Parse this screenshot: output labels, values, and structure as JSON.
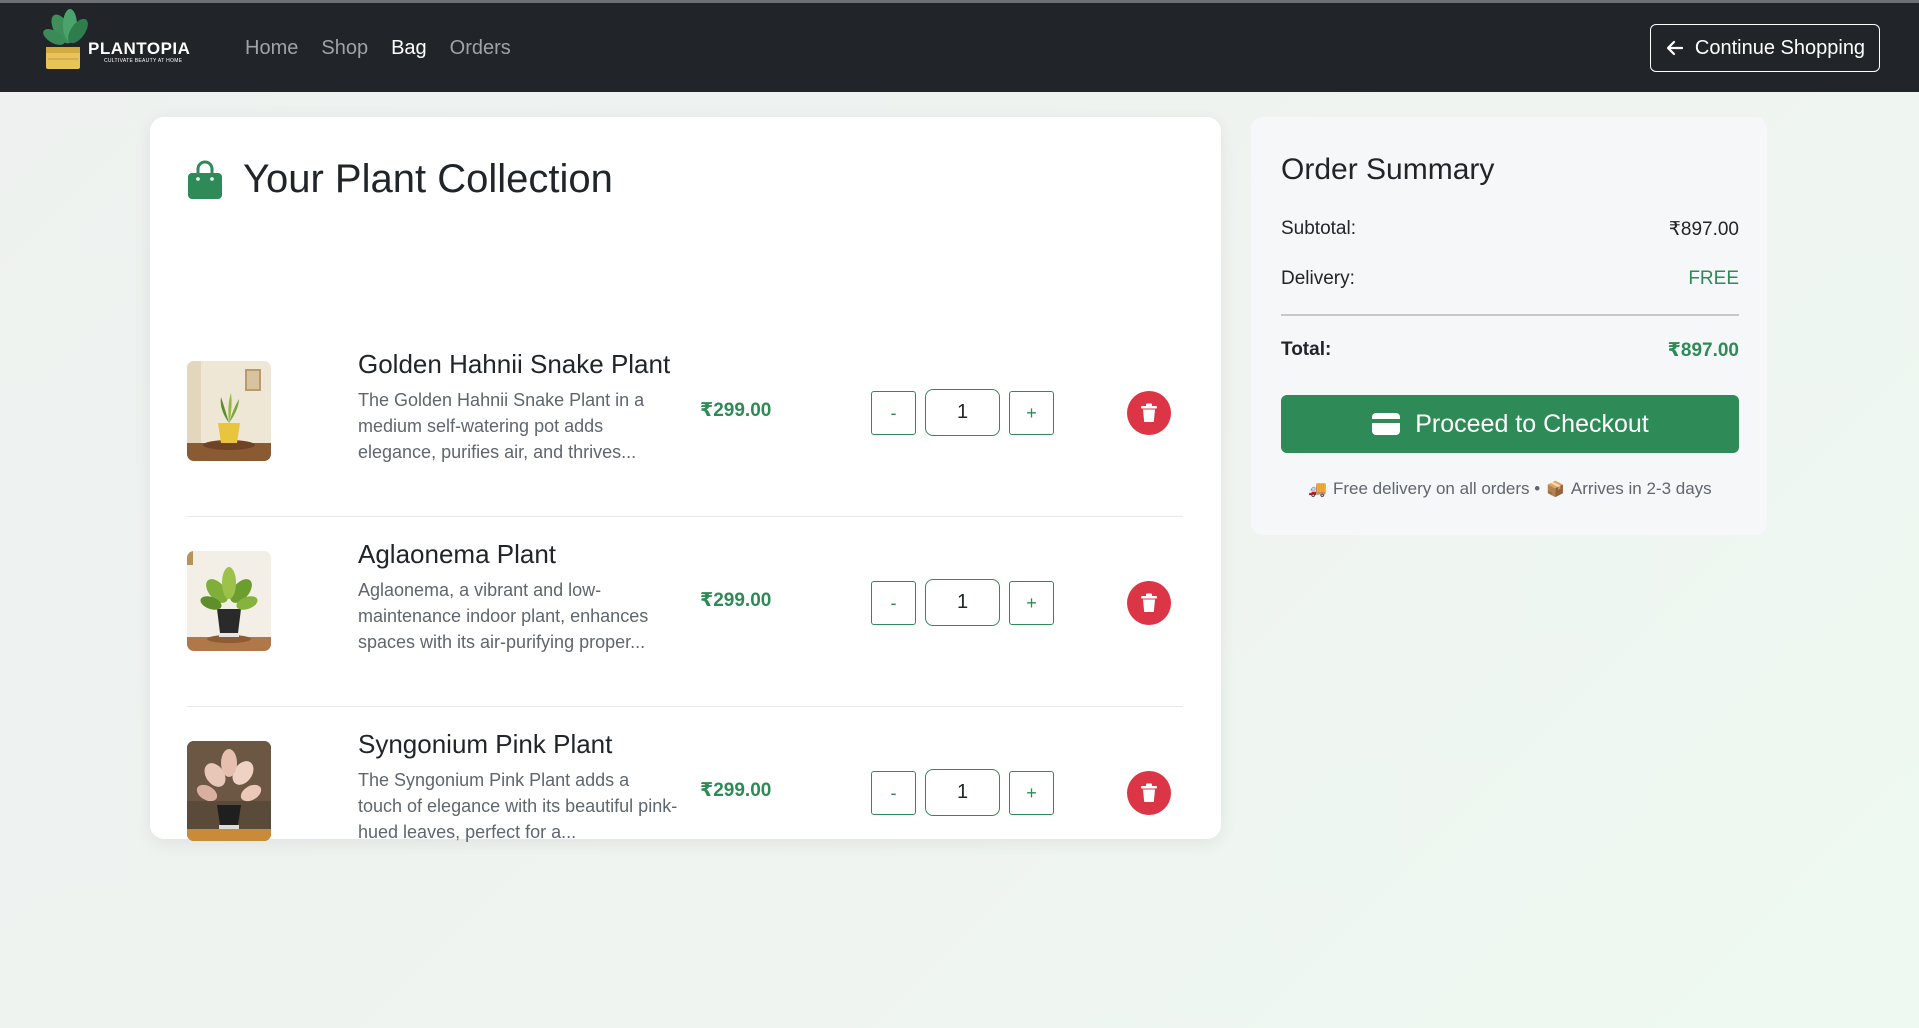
{
  "nav": {
    "brand_name": "PLANTOPIA",
    "brand_tagline": "CULTIVATE BEAUTY AT HOME",
    "links": [
      {
        "label": "Home",
        "active": false
      },
      {
        "label": "Shop",
        "active": false
      },
      {
        "label": "Bag",
        "active": true
      },
      {
        "label": "Orders",
        "active": false
      }
    ],
    "continue_label": "Continue Shopping",
    "continue_icon": "arrow-left-icon"
  },
  "cart": {
    "title": "Your Plant Collection",
    "icon": "shopping-bag-icon",
    "items": [
      {
        "name": "Golden Hahnii Snake Plant",
        "description": "The Golden Hahnii Snake Plant in a medium self-watering pot adds elegance, purifies air, and thrives...",
        "price": "₹299.00",
        "quantity": "1",
        "minus_label": "-",
        "plus_label": "+"
      },
      {
        "name": "Aglaonema Plant",
        "description": "Aglaonema, a vibrant and low-maintenance indoor plant, enhances spaces with its air-purifying proper...",
        "price": "₹299.00",
        "quantity": "1",
        "minus_label": "-",
        "plus_label": "+"
      },
      {
        "name": "Syngonium Pink Plant",
        "description": "The Syngonium Pink Plant adds a touch of elegance with its beautiful pink-hued leaves, perfect for a...",
        "price": "₹299.00",
        "quantity": "1",
        "minus_label": "-",
        "plus_label": "+"
      }
    ]
  },
  "summary": {
    "title": "Order Summary",
    "subtotal_label": "Subtotal:",
    "subtotal_value": "₹897.00",
    "delivery_label": "Delivery:",
    "delivery_value": "FREE",
    "total_label": "Total:",
    "total_value": "₹897.00",
    "checkout_label": "Proceed to Checkout",
    "note_delivery": "Free delivery on all orders •",
    "note_arrival": "Arrives in 2-3 days"
  },
  "colors": {
    "accent": "#2e8b57",
    "danger": "#dc3545",
    "navbar": "#212529"
  }
}
